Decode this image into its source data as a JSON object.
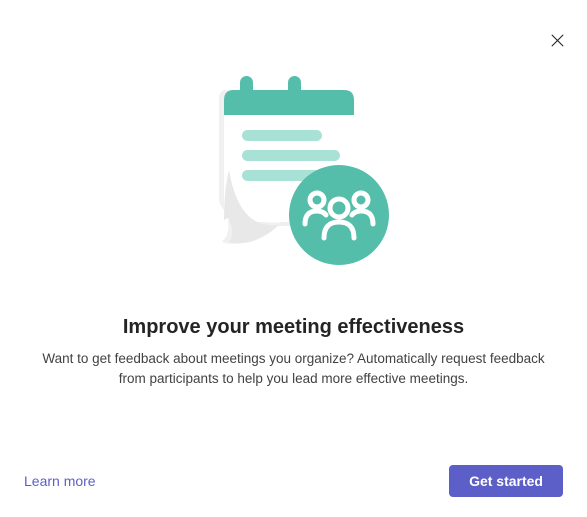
{
  "dialog": {
    "title": "Improve your meeting effectiveness",
    "description": "Want to get feedback about meetings you organize? Automatically request feedback from participants to help you lead more effective meetings."
  },
  "footer": {
    "learn_more_label": "Learn more",
    "get_started_label": "Get started"
  },
  "icons": {
    "close": "close-icon",
    "illustration": "calendar-people-illustration"
  },
  "colors": {
    "accent": "#5B5FC7",
    "teal_dark": "#55BEAA",
    "teal_light": "#A8E1D5"
  }
}
